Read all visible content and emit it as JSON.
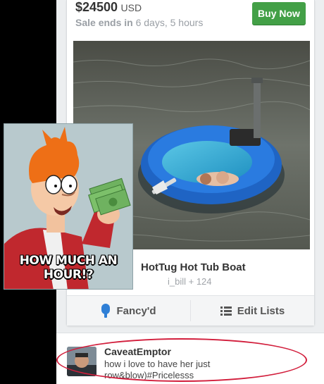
{
  "listing": {
    "price": "$24500",
    "currency": "USD",
    "sale_label": "Sale ends in",
    "sale_time": "6 days, 5 hours",
    "buy_label": "Buy Now",
    "title": "HotTug Hot Tub Boat",
    "user": "i_bill + 124"
  },
  "actions": {
    "fancy_label": "Fancy'd",
    "edit_label": "Edit Lists"
  },
  "comment": {
    "author": "CaveatEmptor",
    "text": "how i love to have her just row&blow)#Pricelesss"
  },
  "meme": {
    "caption_line1": "HOW MUCH AN",
    "caption_line2": "HOUR!?"
  },
  "colors": {
    "buy_button": "#43a047",
    "fancy_icon": "#2f7fd6",
    "annotation_circle": "#d21e3c"
  }
}
